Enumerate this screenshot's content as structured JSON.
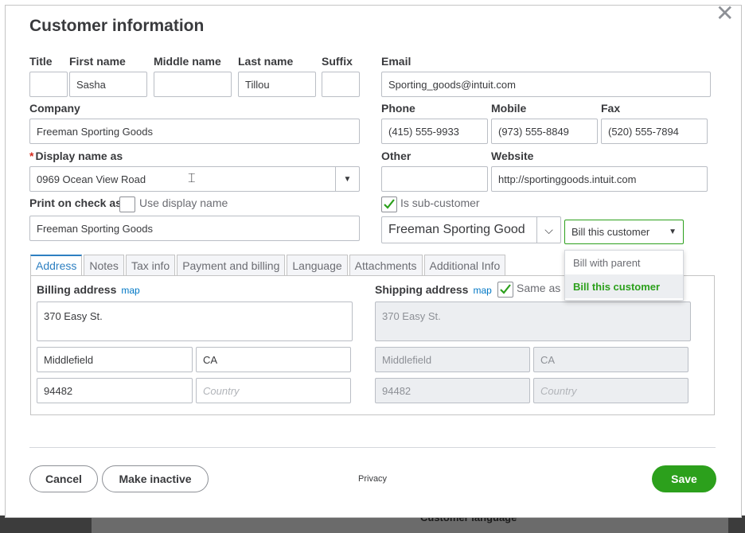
{
  "dialog": {
    "title": "Customer information",
    "close_icon": "close-icon"
  },
  "name": {
    "title_label": "Title",
    "first_label": "First name",
    "middle_label": "Middle name",
    "last_label": "Last name",
    "suffix_label": "Suffix",
    "title_value": "",
    "first_value": "Sasha",
    "middle_value": "",
    "last_value": "Tillou",
    "suffix_value": ""
  },
  "contact": {
    "email_label": "Email",
    "email_value": "Sporting_goods@intuit.com",
    "phone_label": "Phone",
    "phone_value": "(415) 555-9933",
    "mobile_label": "Mobile",
    "mobile_value": "(973) 555-8849",
    "fax_label": "Fax",
    "fax_value": "(520) 555-7894",
    "other_label": "Other",
    "other_value": "",
    "website_label": "Website",
    "website_value": "http://sportinggoods.intuit.com"
  },
  "company": {
    "label": "Company",
    "value": "Freeman Sporting Goods"
  },
  "display_name": {
    "required_mark": "*",
    "label": "Display name as",
    "value": "0969 Ocean View Road"
  },
  "print_check": {
    "label": "Print on check as",
    "use_display_label": "Use display name",
    "use_display_checked": false,
    "value": "Freeman Sporting Goods"
  },
  "sub_customer": {
    "label": "Is sub-customer",
    "checked": true,
    "parent_value": "Freeman Sporting Good",
    "bill_value": "Bill this customer",
    "bill_options": [
      "Bill with parent",
      "Bill this customer"
    ]
  },
  "tabs": [
    {
      "label": "Address"
    },
    {
      "label": "Notes"
    },
    {
      "label": "Tax info"
    },
    {
      "label": "Payment and billing"
    },
    {
      "label": "Language"
    },
    {
      "label": "Attachments"
    },
    {
      "label": "Additional Info"
    }
  ],
  "billing": {
    "label": "Billing address",
    "map_label": "map",
    "street": "370 Easy St.",
    "city": "Middlefield",
    "state": "CA",
    "zip": "94482",
    "country_placeholder": "Country"
  },
  "shipping": {
    "label": "Shipping address",
    "map_label": "map",
    "same_as_label": "Same as",
    "same_as_checked": true,
    "street": "370 Easy St.",
    "city": "Middlefield",
    "state": "CA",
    "zip": "94482",
    "country_placeholder": "Country"
  },
  "footer": {
    "cancel_label": "Cancel",
    "inactive_label": "Make inactive",
    "privacy_label": "Privacy",
    "save_label": "Save"
  },
  "backdrop": {
    "text": "Customer language"
  },
  "colors": {
    "accent_green": "#2ca01c",
    "link_blue": "#0077c5",
    "required_red": "#d52b1e"
  }
}
